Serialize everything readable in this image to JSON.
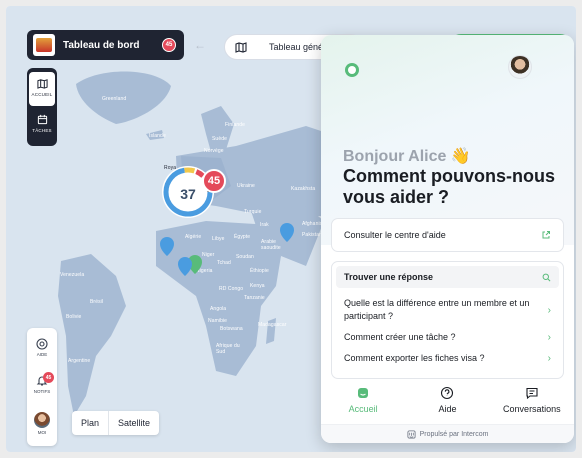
{
  "header": {
    "title": "Tableau de bord",
    "title_badge": "45",
    "tab_label": "Tableau général"
  },
  "sidebar": {
    "items": [
      {
        "label": "ACCUEIL",
        "icon": "map-icon",
        "active": true
      },
      {
        "label": "TÂCHES",
        "icon": "calendar-icon",
        "active": false
      }
    ],
    "bottom_items": [
      {
        "label": "AIDE",
        "icon": "lifebuoy-icon"
      },
      {
        "label": "NOTIFS",
        "icon": "bell-icon",
        "badge": "45"
      },
      {
        "label": "MOI",
        "icon": "avatar"
      }
    ]
  },
  "map": {
    "labels": [
      "Greenland",
      "Islande",
      "Suède",
      "Finlande",
      "Norvège",
      "Roya",
      "Ukraine",
      "Kazakhsta",
      "Turquie",
      "Irak",
      "Afghanista",
      "Algérie",
      "Libye",
      "Égypte",
      "Arabie saoudite",
      "Pakistan",
      "Niger",
      "Tchad",
      "Soudan",
      "Nigeria",
      "Éthiopie",
      "Kenya",
      "RD Congo",
      "Tanzanie",
      "Angola",
      "Namibie",
      "Botswana",
      "Madagascar",
      "Afrique du Sud",
      "Venezuela",
      "Brésil",
      "Bolivie",
      "Argentine"
    ],
    "cluster_main": "37",
    "cluster_alert": "45",
    "layer_options": [
      "Plan",
      "Satellite"
    ],
    "accent": "#58bb7a",
    "alert_color": "#e44a5a"
  },
  "intercom": {
    "greeting": "Bonjour Alice 👋",
    "question": "Comment pouvons-nous vous aider ?",
    "help_center": "Consulter le centre d'aide",
    "search_label": "Trouver une réponse",
    "faq": [
      "Quelle est la différence entre un membre et un participant ?",
      "Comment créer une tâche ?",
      "Comment exporter les fiches visa ?"
    ],
    "nav": [
      "Accueil",
      "Aide",
      "Conversations"
    ],
    "powered_by": "Propulsé par Intercom"
  }
}
